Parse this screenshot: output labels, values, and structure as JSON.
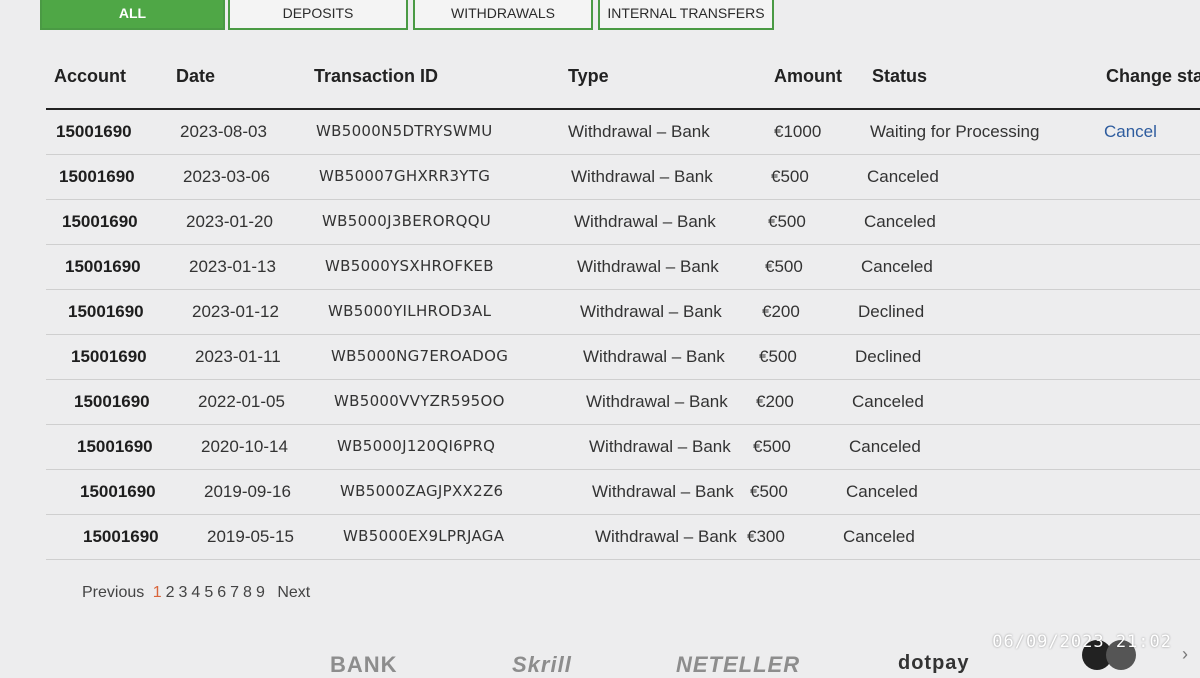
{
  "tabs": [
    {
      "label": "ALL",
      "active": true
    },
    {
      "label": "DEPOSITS"
    },
    {
      "label": "WITHDRAWALS"
    },
    {
      "label": "INTERNAL TRANSFERS"
    }
  ],
  "table": {
    "headers": [
      "Account",
      "Date",
      "Transaction ID",
      "Type",
      "Amount",
      "Status",
      "Change statu"
    ],
    "rows": [
      {
        "account": "15001690",
        "date": "2023-08-03",
        "id": "WB5000N5DTRYSWMU",
        "type": "Withdrawal – Bank",
        "amount": "€1000",
        "status": "Waiting for Processing",
        "action": "Cancel"
      },
      {
        "account": "15001690",
        "date": "2023-03-06",
        "id": "WB50007GHXRR3YTG",
        "type": "Withdrawal – Bank",
        "amount": "€500",
        "status": "Canceled",
        "action": ""
      },
      {
        "account": "15001690",
        "date": "2023-01-20",
        "id": "WB5000J3BERORQQU",
        "type": "Withdrawal – Bank",
        "amount": "€500",
        "status": "Canceled",
        "action": ""
      },
      {
        "account": "15001690",
        "date": "2023-01-13",
        "id": "WB5000YSXHROFKEB",
        "type": "Withdrawal – Bank",
        "amount": "€500",
        "status": "Canceled",
        "action": ""
      },
      {
        "account": "15001690",
        "date": "2023-01-12",
        "id": "WB5000YILHROD3AL",
        "type": "Withdrawal – Bank",
        "amount": "€200",
        "status": "Declined",
        "action": ""
      },
      {
        "account": "15001690",
        "date": "2023-01-11",
        "id": "WB5000NG7EROADOG",
        "type": "Withdrawal – Bank",
        "amount": "€500",
        "status": "Declined",
        "action": ""
      },
      {
        "account": "15001690",
        "date": "2022-01-05",
        "id": "WB5000VVYZR595OO",
        "type": "Withdrawal – Bank",
        "amount": "€200",
        "status": "Canceled",
        "action": ""
      },
      {
        "account": "15001690",
        "date": "2020-10-14",
        "id": "WB5000J120QI6PRQ",
        "type": "Withdrawal – Bank",
        "amount": "€500",
        "status": "Canceled",
        "action": ""
      },
      {
        "account": "15001690",
        "date": "2019-09-16",
        "id": "WB5000ZAGJPXX2Z6",
        "type": "Withdrawal – Bank",
        "amount": "€500",
        "status": "Canceled",
        "action": ""
      },
      {
        "account": "15001690",
        "date": "2019-05-15",
        "id": "WB5000EX9LPRJAGA",
        "type": "Withdrawal – Bank",
        "amount": "€300",
        "status": "Canceled",
        "action": ""
      }
    ]
  },
  "pagination": {
    "previous": "Previous",
    "next": "Next",
    "pages": [
      "1",
      "2",
      "3",
      "4",
      "5",
      "6",
      "7",
      "8",
      "9"
    ],
    "current": "1"
  },
  "footer": {
    "logos": [
      "BANK",
      "Skrill",
      "NETELLER",
      "dotpay"
    ]
  },
  "timestamp": "06/09/2023 21:02",
  "colors": {
    "accent": "#4fa746",
    "link": "#2e5c9e",
    "current_page": "#d9653b"
  }
}
